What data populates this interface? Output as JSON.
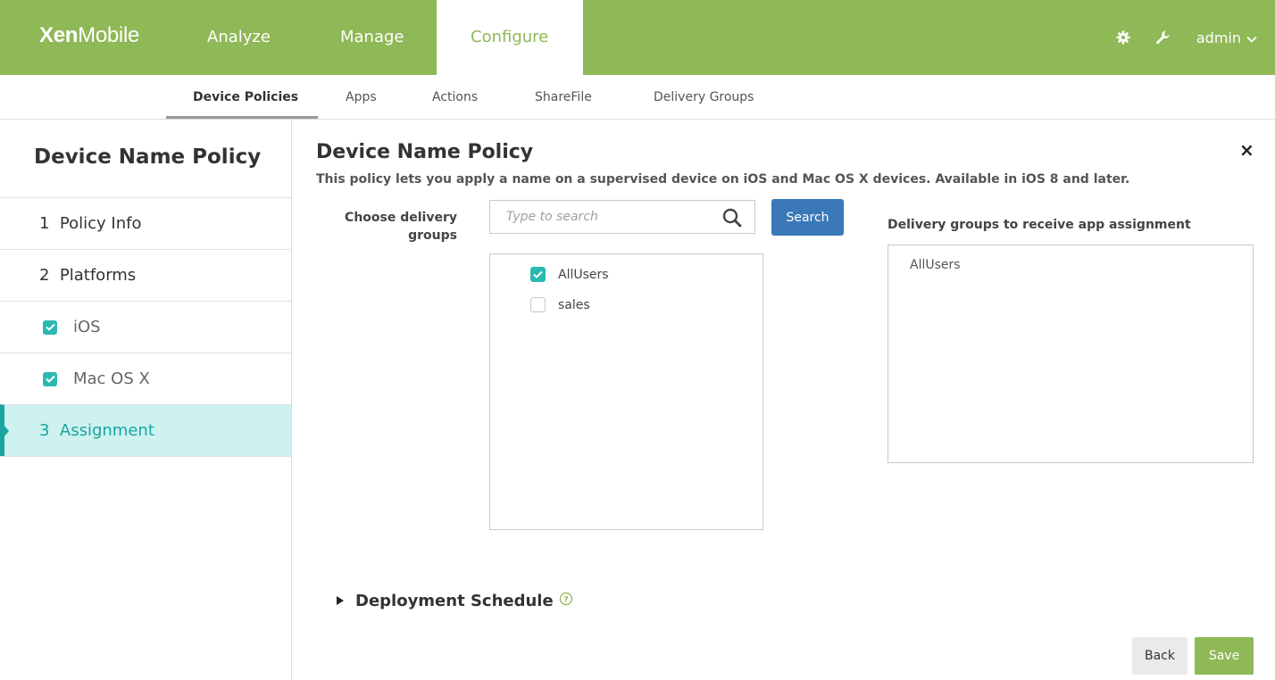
{
  "header": {
    "logo_bold": "Xen",
    "logo_light": "Mobile",
    "nav": [
      {
        "label": "Analyze"
      },
      {
        "label": "Manage"
      },
      {
        "label": "Configure",
        "active": true
      }
    ],
    "user_label": "admin",
    "icons": [
      "gear-icon",
      "wrench-icon",
      "chevron-down-icon"
    ]
  },
  "subnav": {
    "items": [
      {
        "label": "Device Policies",
        "active": true
      },
      {
        "label": "Apps"
      },
      {
        "label": "Actions"
      },
      {
        "label": "ShareFile"
      },
      {
        "label": "Delivery Groups"
      }
    ]
  },
  "sidebar": {
    "title": "Device Name Policy",
    "items": [
      {
        "label": "1  Policy Info"
      },
      {
        "label": "2  Platforms"
      },
      {
        "label": "iOS",
        "checked": true
      },
      {
        "label": "Mac OS X",
        "checked": true
      },
      {
        "label": "3  Assignment",
        "active": true
      }
    ]
  },
  "main": {
    "title": "Device Name Policy",
    "description": "This policy lets you apply a name on a supervised device on iOS and Mac OS X devices. Available in iOS 8 and later.",
    "choose_label": "Choose delivery groups",
    "search": {
      "placeholder": "Type to search",
      "button_label": "Search"
    },
    "groups": [
      {
        "label": "AllUsers",
        "checked": true
      },
      {
        "label": "sales",
        "checked": false
      }
    ],
    "assigned_label": "Delivery groups to receive app assignment",
    "assigned": [
      "AllUsers"
    ],
    "deployment_schedule_label": "Deployment Schedule",
    "back_label": "Back",
    "save_label": "Save"
  },
  "colors": {
    "brand_green": "#8fb856",
    "teal": "#1aa5a0",
    "button_blue": "#3a78b8",
    "active_bg": "#cdf2ef"
  }
}
